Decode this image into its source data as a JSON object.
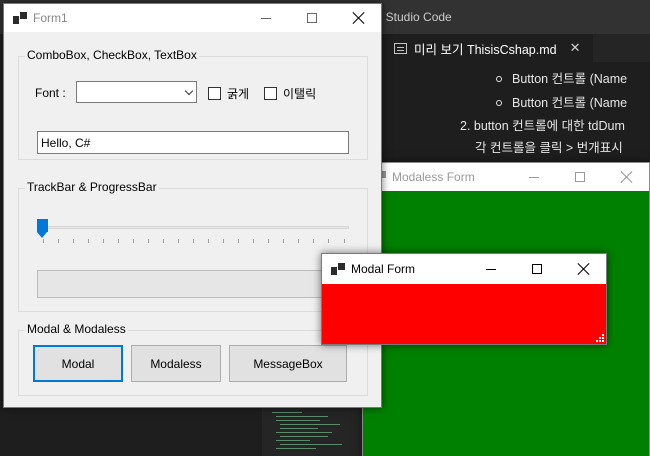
{
  "vscode": {
    "app_title": "al Studio Code",
    "tab_label": "미리 보기 ThisisCshap.md",
    "preview_lines": [
      "Button 컨트롤 (Name",
      "Button 컨트롤 (Name",
      "2. button 컨트롤에 대한 tdDum",
      "각 컨트롤을 클릭 > 번개표시"
    ],
    "colors": {
      "background": "#1e1e1e",
      "titlebar": "#323233",
      "tabbar": "#252526"
    }
  },
  "form1": {
    "title": "Form1",
    "group_combo": {
      "label": "ComboBox, CheckBox, TextBox",
      "font_label": "Font :",
      "combo_value": "",
      "bold_label": "굵게",
      "italic_label": "이탤릭",
      "text_value": "Hello, C#"
    },
    "group_track": {
      "label": "TrackBar & ProgressBar",
      "track_value": 0,
      "track_max": 20,
      "progress_value": 0
    },
    "group_modal": {
      "label": "Modal & Modaless",
      "buttons": [
        "Modal",
        "Modaless",
        "MessageBox"
      ]
    }
  },
  "modaless": {
    "title": "Modaless Form",
    "background_color": "#008000"
  },
  "modal": {
    "title": "Modal Form",
    "background_color": "#ff0000"
  },
  "icons": [
    "form-app-icon",
    "minimize-icon",
    "maximize-icon",
    "close-icon",
    "dropdown-arrow-icon",
    "preview-icon",
    "resize-grip-icon"
  ]
}
